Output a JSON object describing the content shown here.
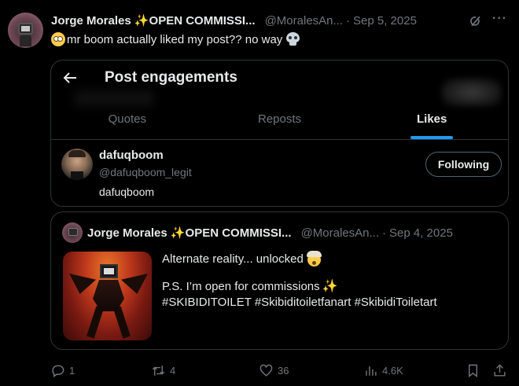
{
  "post": {
    "author_name": "Jorge Morales ✨OPEN COMMISSI...",
    "handle": "@MoralesAn...",
    "dot": "·",
    "date": "Sep 5, 2025",
    "text": "mr boom actually liked my post?? no way",
    "emoji_1": "flushed-face",
    "emoji_2": "skull"
  },
  "card": {
    "title": "Post engagements",
    "tabs": [
      {
        "label": "Quotes",
        "active": false
      },
      {
        "label": "Reposts",
        "active": false
      },
      {
        "label": "Likes",
        "active": true
      }
    ],
    "user": {
      "name": "dafuqboom",
      "handle": "@dafuqboom_legit",
      "bio": "dafuqboom",
      "button_label": "Following"
    }
  },
  "quote": {
    "author_name": "Jorge Morales ✨OPEN COMMISSI...",
    "handle": "@MoralesAn...",
    "dot": "·",
    "date": "Sep 4, 2025",
    "line1": "Alternate reality... unlocked",
    "line2": "P.S. I’m open for commissions",
    "line3": "#SKIBIDITOILET #Skibiditoiletfanart #SkibidiToiletart"
  },
  "actions": {
    "replies": "1",
    "reposts": "4",
    "likes": "36",
    "views": "4.6K"
  },
  "colors": {
    "background": "#000000",
    "text": "#e7e9ea",
    "muted": "#71767b",
    "accent": "#1d9bf0",
    "border": "#2f3336"
  }
}
